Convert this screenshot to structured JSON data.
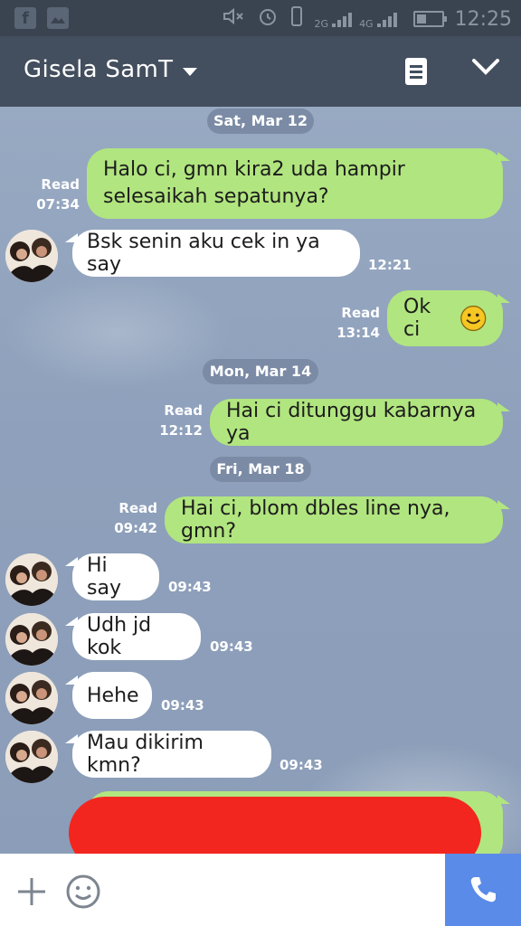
{
  "status_bar": {
    "time": "12:25",
    "network_1": "2G",
    "network_2": "4G",
    "network_3": "4G",
    "sim_1": "1",
    "icons": [
      "facebook-icon",
      "gallery-icon",
      "mute-icon",
      "alarm-icon",
      "vibrate-icon",
      "signal-icon",
      "battery-icon"
    ]
  },
  "header": {
    "title": "Gisela SamT",
    "icons": [
      "dropdown-caret-icon",
      "notes-icon",
      "chevron-down-icon"
    ]
  },
  "dates": {
    "d1": "Sat, Mar 12",
    "d2": "Mon, Mar 14",
    "d3": "Fri, Mar 18"
  },
  "messages": [
    {
      "dir": "out",
      "line1": "Halo ci, gmn kira2 uda hampir",
      "line2": "selesaikah sepatunya?",
      "read": "Read",
      "time": "07:34"
    },
    {
      "dir": "in",
      "text": "Bsk senin aku cek in ya say",
      "time": "12:21"
    },
    {
      "dir": "out",
      "text": "Ok ci",
      "emoji": "smile-emoji",
      "read": "Read",
      "time": "13:14"
    },
    {
      "dir": "out",
      "text": "Hai ci ditunggu kabarnya ya",
      "read": "Read",
      "time": "12:12"
    },
    {
      "dir": "out",
      "text": "Hai ci, blom dbles line nya, gmn?",
      "read": "Read",
      "time": "09:42"
    },
    {
      "dir": "in",
      "text": "Hi say",
      "time": "09:43"
    },
    {
      "dir": "in",
      "text": "Udh jd kok",
      "time": "09:43"
    },
    {
      "dir": "in",
      "text": "Hehe",
      "time": "09:43"
    },
    {
      "dir": "in",
      "text": "Mau dikirim kmn?",
      "time": "09:43"
    }
  ],
  "colors": {
    "header_bg": "#434e5e",
    "outgoing_bubble": "#b1e57f",
    "incoming_bubble": "#ffffff",
    "redaction": "#f2261f",
    "call_button": "#5b8be8"
  },
  "bottom_bar": {
    "icons": [
      "plus-icon",
      "emoji-icon",
      "phone-icon"
    ]
  }
}
